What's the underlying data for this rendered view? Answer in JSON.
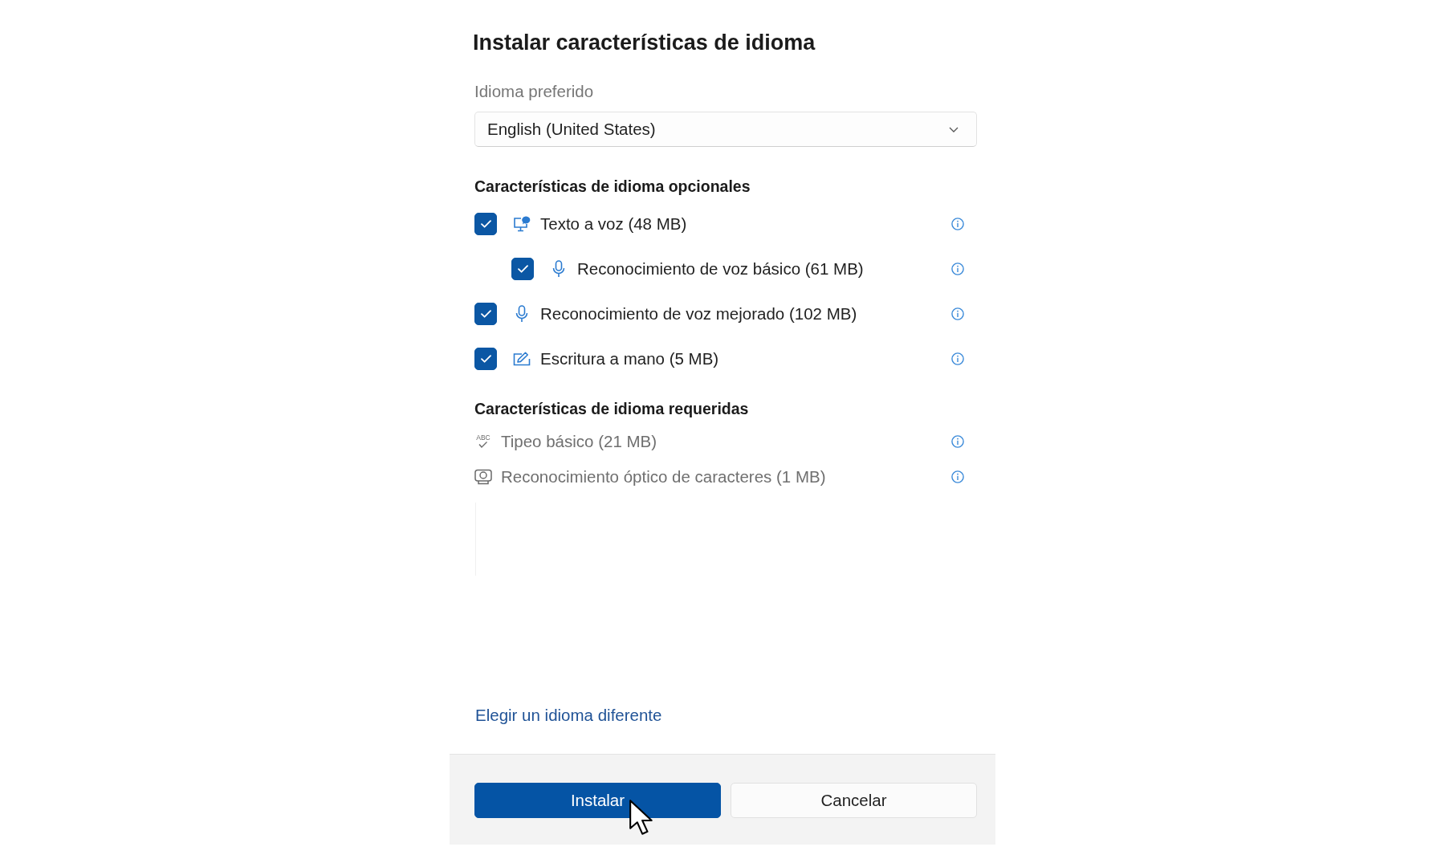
{
  "dialog": {
    "title": "Instalar características de idioma"
  },
  "preferred_language": {
    "label": "Idioma preferido",
    "value": "English (United States)"
  },
  "sections": [
    {
      "heading": "Características de idioma opcionales",
      "kind": "optional",
      "items": [
        {
          "kind": "tts",
          "label": "Texto a voz (48 MB)",
          "checked": true,
          "children": [
            {
              "kind": "speech",
              "label": "Reconocimiento de voz básico (61 MB)",
              "checked": true
            }
          ]
        },
        {
          "kind": "speech",
          "label": "Reconocimiento de voz mejorado (102 MB)",
          "checked": true
        },
        {
          "kind": "handwriting",
          "label": "Escritura a mano (5 MB)",
          "checked": true
        }
      ]
    },
    {
      "heading": "Características de idioma requeridas",
      "kind": "required",
      "items": [
        {
          "kind": "typing",
          "label": "Tipeo básico (21 MB)",
          "icon_text": "ABC"
        },
        {
          "kind": "ocr",
          "label": "Reconocimiento óptico de caracteres (1 MB)"
        }
      ]
    }
  ],
  "link": "Elegir un idioma diferente",
  "buttons": [
    {
      "label": "Instalar",
      "kind": "primary"
    },
    {
      "label": "Cancelar",
      "kind": "secondary"
    }
  ]
}
